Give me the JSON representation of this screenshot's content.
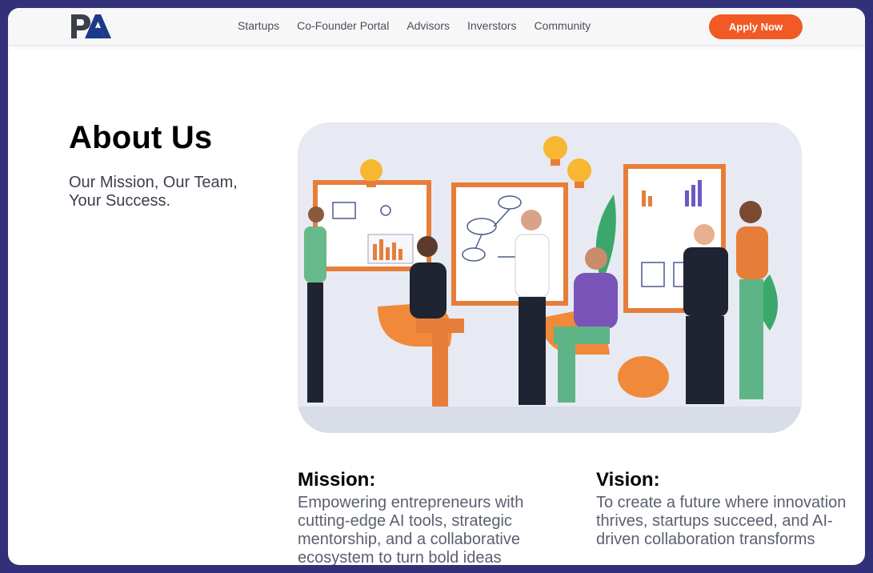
{
  "header": {
    "logo_text": "PA",
    "nav_items": [
      {
        "label": "Startups"
      },
      {
        "label": "Co-Founder Portal"
      },
      {
        "label": "Advisors"
      },
      {
        "label": "Inverstors"
      },
      {
        "label": "Community"
      }
    ],
    "apply_label": "Apply Now"
  },
  "main": {
    "title": "About Us",
    "subtitle": "Our Mission, Our Team, Your Success.",
    "hero_image": "team-collaboration-illustration",
    "mission": {
      "heading": "Mission:",
      "text": "Empowering entrepreneurs with cutting-edge AI tools, strategic mentorship, and a collaborative ecosystem to turn bold ideas"
    },
    "vision": {
      "heading": "Vision:",
      "text": "To create a future where innovation thrives, startups succeed, and AI-driven collaboration transforms"
    }
  },
  "colors": {
    "background_frame": "#33307a",
    "accent": "#f15a24",
    "navy": "#1d3a8a",
    "text_dark": "#000000",
    "text_muted": "#5b6070"
  }
}
